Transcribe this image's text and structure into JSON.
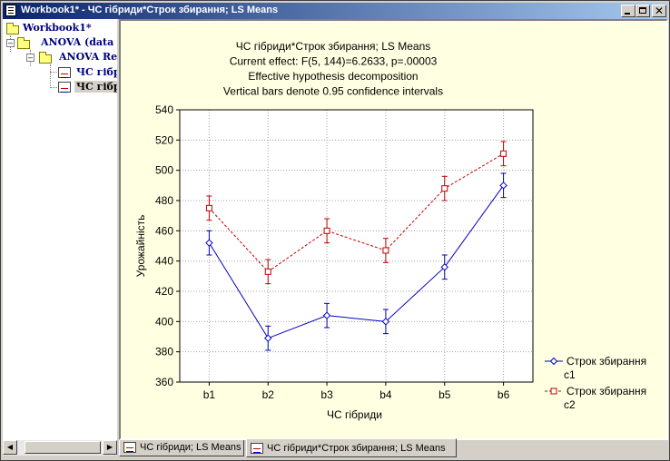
{
  "window": {
    "title": "Workbook1* - ЧС гібриди*Строк збирання; LS Means",
    "controls": {
      "minimize": "minimize",
      "maximize": "maximize",
      "close": "✕"
    }
  },
  "tree": {
    "root": "Workbook1*",
    "level1": "ANOVA (data",
    "level2": "ANOVA Re",
    "leaf1": "ЧС гібрі",
    "leaf2": "ЧС гібрі"
  },
  "tabs": [
    "ЧС гібриди; LS Means",
    "ЧС гібриди*Строк збирання; LS Means"
  ],
  "icons": {
    "app": "workbook-icon",
    "folder": "folder-icon",
    "graph": "graph-doc-icon",
    "expand": "plus-minus-icon",
    "scroll_left": "arrow-left-icon",
    "scroll_right": "arrow-right-icon"
  },
  "chart_data": {
    "type": "line",
    "title_lines": [
      "ЧС гібриди*Строк збирання; LS Means",
      "Current effect: F(5, 144)=6.2633, p=.00003",
      "Effective hypothesis decomposition",
      "Vertical bars denote 0.95 confidence intervals"
    ],
    "xlabel": "ЧС гібриди",
    "ylabel": "Урожайність",
    "categories": [
      "b1",
      "b2",
      "b3",
      "b4",
      "b5",
      "b6"
    ],
    "ylim": [
      360,
      540
    ],
    "yticks": [
      360,
      380,
      400,
      420,
      440,
      460,
      480,
      500,
      520,
      540
    ],
    "grid": true,
    "legend_position": "right",
    "series": [
      {
        "name": "Строк збирання c1",
        "legend_lines": [
          "Строк збирання",
          "c1"
        ],
        "color": "#0000c0",
        "line": "solid",
        "marker": "diamond",
        "values": [
          452,
          389,
          404,
          400,
          436,
          490
        ],
        "ci_low": [
          444,
          381,
          396,
          392,
          428,
          482
        ],
        "ci_high": [
          460,
          397,
          412,
          408,
          444,
          498
        ]
      },
      {
        "name": "Строк збирання c2",
        "legend_lines": [
          "Строк збирання",
          "c2"
        ],
        "color": "#c00000",
        "line": "dashed",
        "marker": "square",
        "values": [
          475,
          433,
          460,
          447,
          488,
          511
        ],
        "ci_low": [
          467,
          425,
          452,
          439,
          480,
          503
        ],
        "ci_high": [
          483,
          441,
          468,
          455,
          496,
          519
        ]
      }
    ]
  }
}
